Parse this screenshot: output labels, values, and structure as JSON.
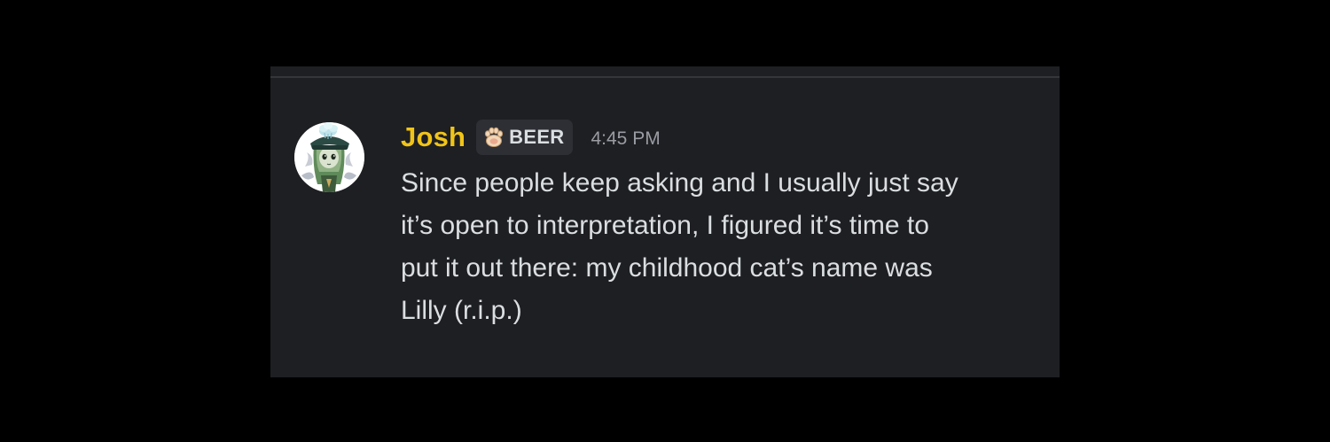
{
  "message": {
    "author": {
      "name": "Josh",
      "name_color": "#f0c419",
      "avatar_icon": "anime-character-avatar-icon"
    },
    "tag": {
      "icon": "cat-paw-icon",
      "label": "BEER"
    },
    "timestamp": "4:45 PM",
    "content": "Since people keep asking and I usually just say\nit’s open to interpretation, I figured it’s time to\nput it out there: my childhood cat’s name was\nLilly (r.i.p.)"
  },
  "colors": {
    "page_background": "#000000",
    "card_background": "#1e1f22",
    "text": "#dbdee1",
    "muted": "#9a9ca3"
  }
}
